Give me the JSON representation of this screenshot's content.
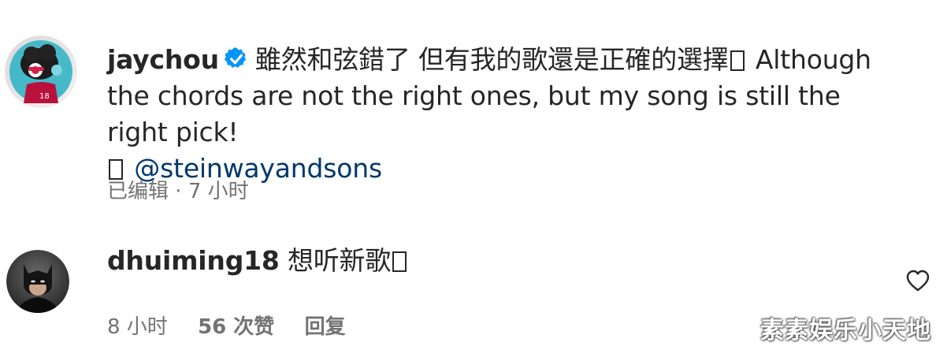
{
  "comments": [
    {
      "username": "jaychou",
      "verified": true,
      "text_zh": "雖然和弦錯了 但有我的歌還是正確的選擇",
      "text_en": "Although the chords are not the right ones, but my song is still the right pick!",
      "mention": "@steinwayandsons",
      "edited_label": "已编辑",
      "separator": "·",
      "time": "7 小时"
    },
    {
      "username": "dhuiming18",
      "text": "想听新歌",
      "time": "8 小时",
      "likes": "56 次赞",
      "reply_label": "回复"
    }
  ],
  "watermark": "素素娱乐小天地",
  "colors": {
    "text": "#262626",
    "secondary": "#737373",
    "mention": "#00376b",
    "verified": "#0095f6"
  },
  "icons": {
    "verified": "verified-badge-icon",
    "like": "heart-icon"
  }
}
